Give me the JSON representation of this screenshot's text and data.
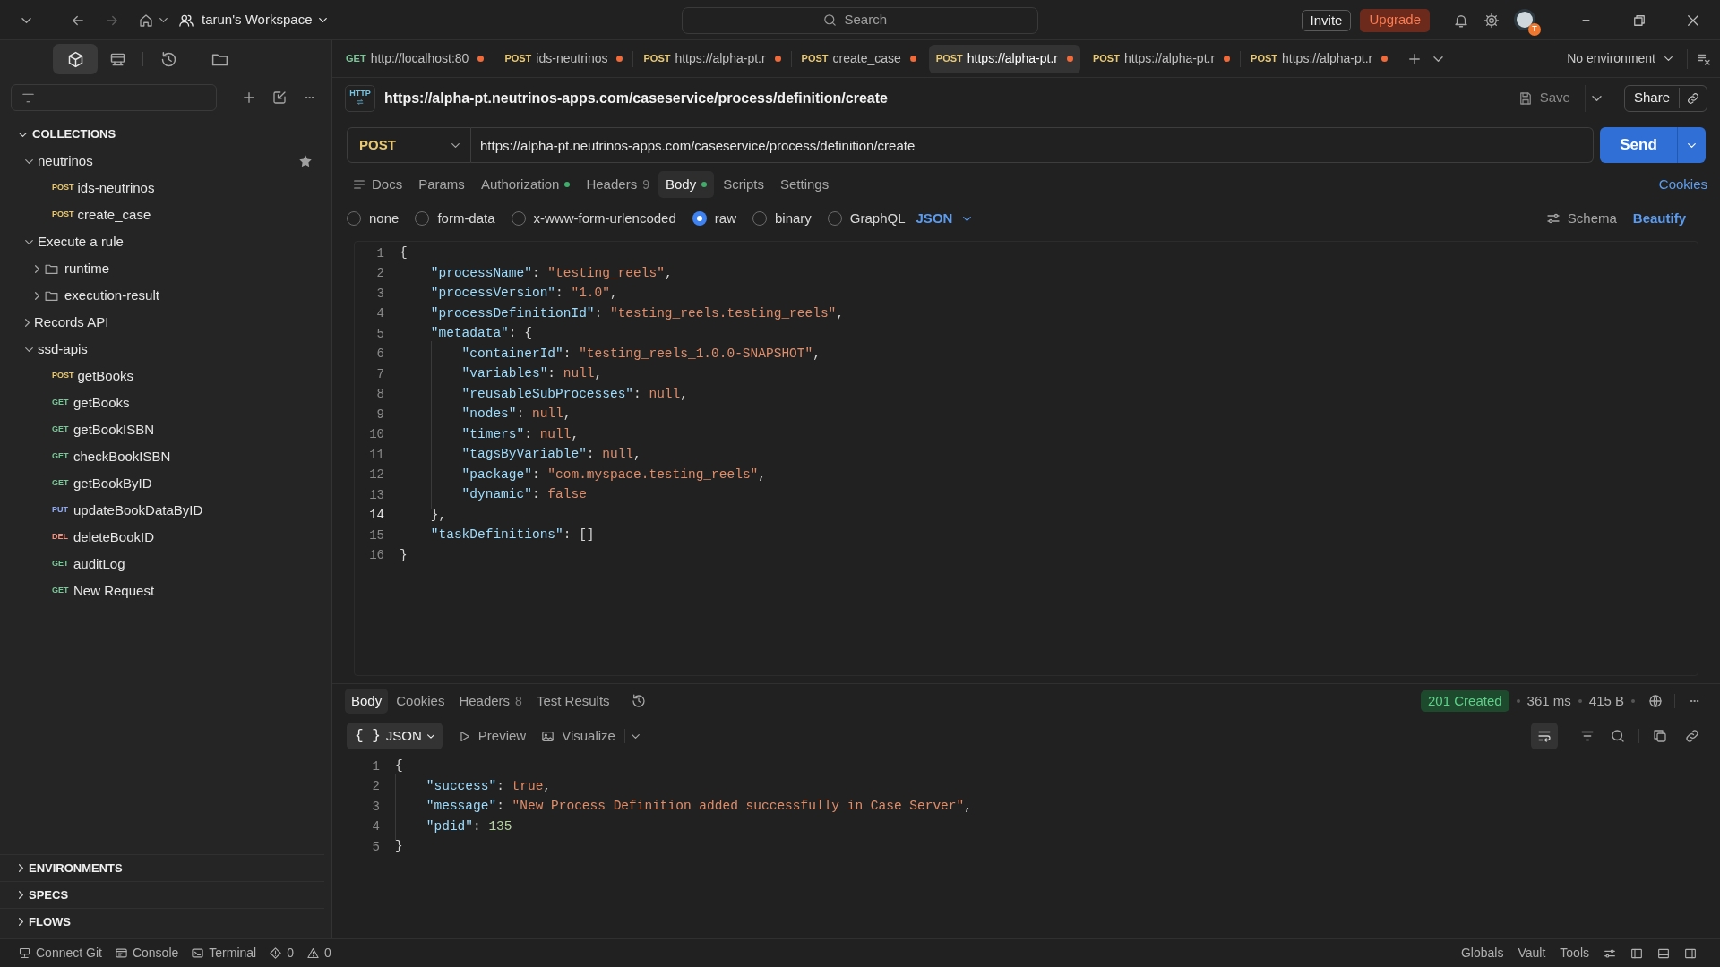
{
  "top_bar": {
    "workspace": "tarun's Workspace",
    "search": {
      "placeholder": "Search"
    },
    "invite": "Invite",
    "upgrade": "Upgrade",
    "avatar_badge": "T"
  },
  "sidebar": {
    "views": [
      {
        "kind": "collections",
        "selected": true
      },
      {
        "kind": "environments",
        "selected": false
      },
      {
        "kind": "history",
        "selected": false
      },
      {
        "kind": "files",
        "selected": false
      }
    ],
    "section_title": "COLLECTIONS",
    "expanded": true,
    "tree": [
      {
        "label": "neutrinos",
        "kind": "collection",
        "expanded": true,
        "starred": true,
        "children": [
          {
            "label": "ids-neutrinos",
            "kind": "request",
            "method": "POST",
            "color": "#e8c872"
          },
          {
            "label": "create_case",
            "kind": "request",
            "method": "POST",
            "color": "#e8c872"
          }
        ]
      },
      {
        "label": "Execute a rule",
        "kind": "collection",
        "expanded": true,
        "starred": false,
        "children": [
          {
            "label": "runtime",
            "kind": "folder",
            "expanded": false
          },
          {
            "label": "execution-result",
            "kind": "folder",
            "expanded": false
          }
        ]
      },
      {
        "label": "Records API",
        "kind": "collection",
        "expanded": false,
        "starred": false
      },
      {
        "label": "ssd-apis",
        "kind": "collection",
        "expanded": true,
        "starred": false,
        "children": [
          {
            "label": "getBooks",
            "kind": "request",
            "method": "POST",
            "color": "#e8c872"
          },
          {
            "label": "getBooks",
            "kind": "request",
            "method": "GET",
            "color": "#7cc79a"
          },
          {
            "label": "getBookISBN",
            "kind": "request",
            "method": "GET",
            "color": "#7cc79a"
          },
          {
            "label": "checkBookISBN",
            "kind": "request",
            "method": "GET",
            "color": "#7cc79a"
          },
          {
            "label": "getBookByID",
            "kind": "request",
            "method": "GET",
            "color": "#7cc79a"
          },
          {
            "label": "updateBookDataByID",
            "kind": "request",
            "method": "PUT",
            "color": "#8fa8f0"
          },
          {
            "label": "deleteBookID",
            "kind": "request",
            "method": "DEL",
            "color": "#f0907e"
          },
          {
            "label": "auditLog",
            "kind": "request",
            "method": "GET",
            "color": "#7cc79a"
          },
          {
            "label": "New Request",
            "kind": "request",
            "method": "GET",
            "color": "#7cc79a"
          }
        ]
      }
    ],
    "footer_sections": [
      {
        "label": "ENVIRONMENTS",
        "expanded": false
      },
      {
        "label": "SPECS",
        "expanded": false
      },
      {
        "label": "FLOWS",
        "expanded": false
      }
    ]
  },
  "tabs": [
    {
      "method": "GET",
      "color": "#7cc79a",
      "label": "http://localhost:80",
      "unsaved": true,
      "selected": false
    },
    {
      "method": "POST",
      "color": "#e8c872",
      "label": "ids-neutrinos",
      "unsaved": true,
      "selected": false
    },
    {
      "method": "POST",
      "color": "#e8c872",
      "label": "https://alpha-pt.r",
      "unsaved": true,
      "selected": false
    },
    {
      "method": "POST",
      "color": "#e8c872",
      "label": "create_case",
      "unsaved": true,
      "selected": false
    },
    {
      "method": "POST",
      "color": "#e8c872",
      "label": "https://alpha-pt.r",
      "unsaved": true,
      "selected": true
    },
    {
      "method": "POST",
      "color": "#e8c872",
      "label": "https://alpha-pt.r",
      "unsaved": true,
      "selected": false
    },
    {
      "method": "POST",
      "color": "#e8c872",
      "label": "https://alpha-pt.r",
      "unsaved": true,
      "selected": false
    }
  ],
  "environment": "No environment",
  "request": {
    "icon_text": "HTTP",
    "title": "https://alpha-pt.neutrinos-apps.com/caseservice/process/definition/create",
    "save": "Save",
    "share": "Share",
    "method": {
      "label": "POST",
      "color": "#e8c872"
    },
    "url": "https://alpha-pt.neutrinos-apps.com/caseservice/process/definition/create",
    "send": "Send",
    "tabs": [
      {
        "label": "Docs",
        "kind": "docs",
        "dot": false,
        "selected": false
      },
      {
        "label": "Params",
        "kind": "plain",
        "dot": false,
        "selected": false
      },
      {
        "label": "Authorization",
        "kind": "plain",
        "dot": true,
        "selected": false
      },
      {
        "label": "Headers",
        "kind": "plain",
        "count": "9",
        "dot": false,
        "selected": false
      },
      {
        "label": "Body",
        "kind": "plain",
        "dot": true,
        "selected": true
      },
      {
        "label": "Scripts",
        "kind": "plain",
        "dot": false,
        "selected": false
      },
      {
        "label": "Settings",
        "kind": "plain",
        "dot": false,
        "selected": false
      }
    ],
    "cookies": "Cookies",
    "body_types": [
      {
        "label": "none",
        "selected": false
      },
      {
        "label": "form-data",
        "selected": false
      },
      {
        "label": "x-www-form-urlencoded",
        "selected": false
      },
      {
        "label": "raw",
        "selected": true
      },
      {
        "label": "binary",
        "selected": false
      },
      {
        "label": "GraphQL",
        "selected": false
      }
    ],
    "language": "JSON",
    "schema": "Schema",
    "beautify": "Beautify",
    "code": [
      {
        "number": "1",
        "current": false,
        "tokens": [
          {
            "t": "{",
            "kind": "punct"
          }
        ]
      },
      {
        "number": "2",
        "current": false,
        "tokens": [
          {
            "t": "    \"processName\"",
            "kind": "key"
          },
          {
            "t": ": ",
            "kind": "punct"
          },
          {
            "t": "\"testing_reels\"",
            "kind": "string"
          },
          {
            "t": ",",
            "kind": "punct"
          }
        ]
      },
      {
        "number": "3",
        "current": false,
        "tokens": [
          {
            "t": "    \"processVersion\"",
            "kind": "key"
          },
          {
            "t": ": ",
            "kind": "punct"
          },
          {
            "t": "\"1.0\"",
            "kind": "string"
          },
          {
            "t": ",",
            "kind": "punct"
          }
        ]
      },
      {
        "number": "4",
        "current": false,
        "tokens": [
          {
            "t": "    \"processDefinitionId\"",
            "kind": "key"
          },
          {
            "t": ": ",
            "kind": "punct"
          },
          {
            "t": "\"testing_reels.testing_reels\"",
            "kind": "string"
          },
          {
            "t": ",",
            "kind": "punct"
          }
        ]
      },
      {
        "number": "5",
        "current": false,
        "tokens": [
          {
            "t": "    \"metadata\"",
            "kind": "key"
          },
          {
            "t": ": {",
            "kind": "punct"
          }
        ]
      },
      {
        "number": "6",
        "current": false,
        "tokens": [
          {
            "t": "        \"containerId\"",
            "kind": "key"
          },
          {
            "t": ": ",
            "kind": "punct"
          },
          {
            "t": "\"testing_reels_1.0.0-SNAPSHOT\"",
            "kind": "string"
          },
          {
            "t": ",",
            "kind": "punct"
          }
        ]
      },
      {
        "number": "7",
        "current": false,
        "tokens": [
          {
            "t": "        \"variables\"",
            "kind": "key"
          },
          {
            "t": ": ",
            "kind": "punct"
          },
          {
            "t": "null",
            "kind": "literal"
          },
          {
            "t": ",",
            "kind": "punct"
          }
        ]
      },
      {
        "number": "8",
        "current": false,
        "tokens": [
          {
            "t": "        \"reusableSubProcesses\"",
            "kind": "key"
          },
          {
            "t": ": ",
            "kind": "punct"
          },
          {
            "t": "null",
            "kind": "literal"
          },
          {
            "t": ",",
            "kind": "punct"
          }
        ]
      },
      {
        "number": "9",
        "current": false,
        "tokens": [
          {
            "t": "        \"nodes\"",
            "kind": "key"
          },
          {
            "t": ": ",
            "kind": "punct"
          },
          {
            "t": "null",
            "kind": "literal"
          },
          {
            "t": ",",
            "kind": "punct"
          }
        ]
      },
      {
        "number": "10",
        "current": false,
        "tokens": [
          {
            "t": "        \"timers\"",
            "kind": "key"
          },
          {
            "t": ": ",
            "kind": "punct"
          },
          {
            "t": "null",
            "kind": "literal"
          },
          {
            "t": ",",
            "kind": "punct"
          }
        ]
      },
      {
        "number": "11",
        "current": false,
        "tokens": [
          {
            "t": "        \"tagsByVariable\"",
            "kind": "key"
          },
          {
            "t": ": ",
            "kind": "punct"
          },
          {
            "t": "null",
            "kind": "literal"
          },
          {
            "t": ",",
            "kind": "punct"
          }
        ]
      },
      {
        "number": "12",
        "current": false,
        "tokens": [
          {
            "t": "        \"package\"",
            "kind": "key"
          },
          {
            "t": ": ",
            "kind": "punct"
          },
          {
            "t": "\"com.myspace.testing_reels\"",
            "kind": "string"
          },
          {
            "t": ",",
            "kind": "punct"
          }
        ]
      },
      {
        "number": "13",
        "current": false,
        "tokens": [
          {
            "t": "        \"dynamic\"",
            "kind": "key"
          },
          {
            "t": ": ",
            "kind": "punct"
          },
          {
            "t": "false",
            "kind": "literal"
          }
        ]
      },
      {
        "number": "14",
        "current": true,
        "tokens": [
          {
            "t": "    },",
            "kind": "punct"
          }
        ]
      },
      {
        "number": "15",
        "current": false,
        "tokens": [
          {
            "t": "    \"taskDefinitions\"",
            "kind": "key"
          },
          {
            "t": ": []",
            "kind": "punct"
          }
        ]
      },
      {
        "number": "16",
        "current": false,
        "tokens": [
          {
            "t": "}",
            "kind": "punct"
          }
        ]
      }
    ]
  },
  "response": {
    "tabs": [
      {
        "label": "Body",
        "selected": true
      },
      {
        "label": "Cookies",
        "selected": false
      },
      {
        "label": "Headers",
        "count": "8",
        "selected": false
      },
      {
        "label": "Test Results",
        "selected": false
      }
    ],
    "status": "201 Created",
    "time": "361 ms",
    "size": "415 B",
    "format": {
      "icon": "{ }",
      "label": "JSON"
    },
    "preview": "Preview",
    "visualize": "Visualize",
    "code": [
      {
        "number": "1",
        "current": false,
        "tokens": [
          {
            "t": "{",
            "kind": "punct"
          }
        ]
      },
      {
        "number": "2",
        "current": false,
        "tokens": [
          {
            "t": "    \"success\"",
            "kind": "key"
          },
          {
            "t": ": ",
            "kind": "punct"
          },
          {
            "t": "true",
            "kind": "literal"
          },
          {
            "t": ",",
            "kind": "punct"
          }
        ]
      },
      {
        "number": "3",
        "current": false,
        "tokens": [
          {
            "t": "    \"message\"",
            "kind": "key"
          },
          {
            "t": ": ",
            "kind": "punct"
          },
          {
            "t": "\"New Process Definition added successfully in Case Server\"",
            "kind": "string"
          },
          {
            "t": ",",
            "kind": "punct"
          }
        ]
      },
      {
        "number": "4",
        "current": false,
        "tokens": [
          {
            "t": "    \"pdid\"",
            "kind": "key"
          },
          {
            "t": ": ",
            "kind": "punct"
          },
          {
            "t": "135",
            "kind": "number"
          }
        ]
      },
      {
        "number": "5",
        "current": false,
        "tokens": [
          {
            "t": "}",
            "kind": "punct"
          }
        ]
      }
    ]
  },
  "status_bar": {
    "left": [
      {
        "kind": "git",
        "label": "Connect Git"
      },
      {
        "kind": "console",
        "label": "Console"
      },
      {
        "kind": "terminal",
        "label": "Terminal"
      },
      {
        "kind": "errors",
        "label": "0"
      },
      {
        "kind": "warnings",
        "label": "0"
      }
    ],
    "right": [
      "Globals",
      "Vault",
      "Tools"
    ]
  }
}
